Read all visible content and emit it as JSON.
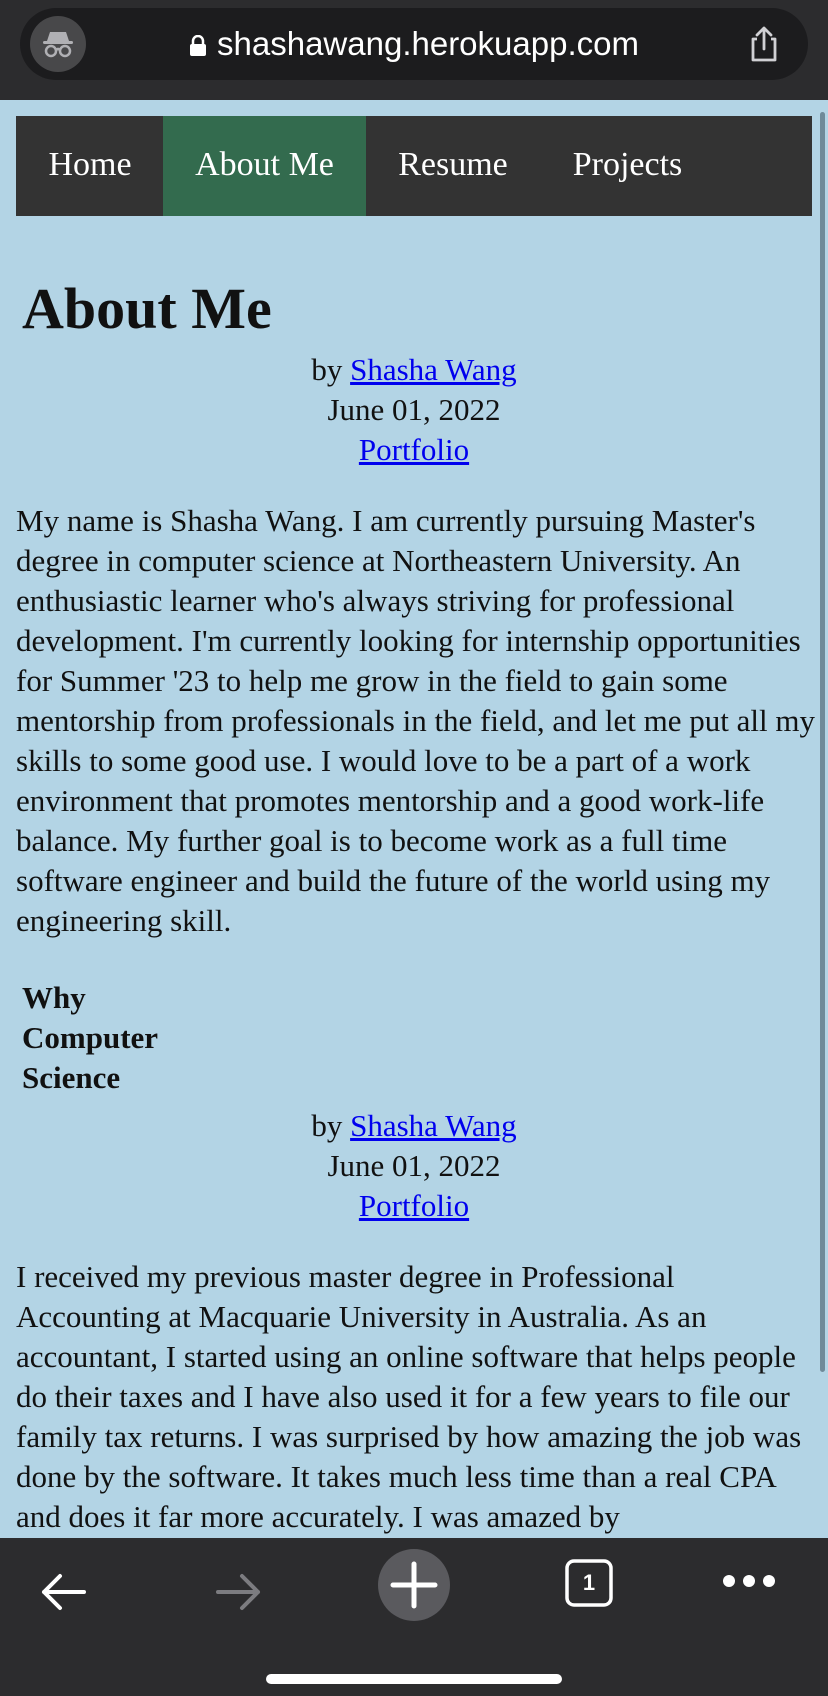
{
  "browser": {
    "url": "shashawang.herokuapp.com",
    "tab_count": "1"
  },
  "nav": {
    "items": [
      {
        "label": "Home"
      },
      {
        "label": "About Me"
      },
      {
        "label": "Resume"
      },
      {
        "label": "Projects"
      }
    ],
    "active_item": "About Me"
  },
  "post1": {
    "title": "About Me",
    "by_prefix": "by",
    "author": "Shasha Wang",
    "date": "June 01, 2022",
    "category": "Portfolio",
    "body": "My name is Shasha Wang. I am currently pursuing Master's degree in computer science at Northeastern University. An enthusiastic learner who's always striving for professional development. I'm currently looking for internship opportunities for Summer '23 to help me grow in the field to gain some mentorship from professionals in the field, and let me put all my skills to some good use. I would love to be a part of a work environment that promotes mentorship and a good work-life balance. My further goal is to become work as a full time software engineer and build the future of the world using my engineering skill."
  },
  "post2": {
    "title": "Why Computer Science",
    "by_prefix": "by",
    "author": "Shasha Wang",
    "date": "June 01, 2022",
    "category": "Portfolio",
    "body": "I received my previous master degree in Professional Accounting at Macquarie University in Australia. As an accountant, I started using an online software that helps people do their taxes and I have also used it for a few years to file our family tax returns. I was surprised by how amazing the job was done by the software. It takes much less time than a real CPA and does it far more accurately. I was amazed by"
  },
  "icons": {
    "incognito": "incognito-icon",
    "lock": "lock-icon",
    "share": "share-icon",
    "back": "back-arrow-icon",
    "forward": "forward-arrow-icon",
    "new_tab": "plus-icon",
    "tabs": "tabs-icon",
    "more": "more-icon"
  },
  "colors": {
    "page_bg": "#b3d4e5",
    "nav_bg": "#333333",
    "nav_active": "#336b4e",
    "link": "#0000ee"
  }
}
